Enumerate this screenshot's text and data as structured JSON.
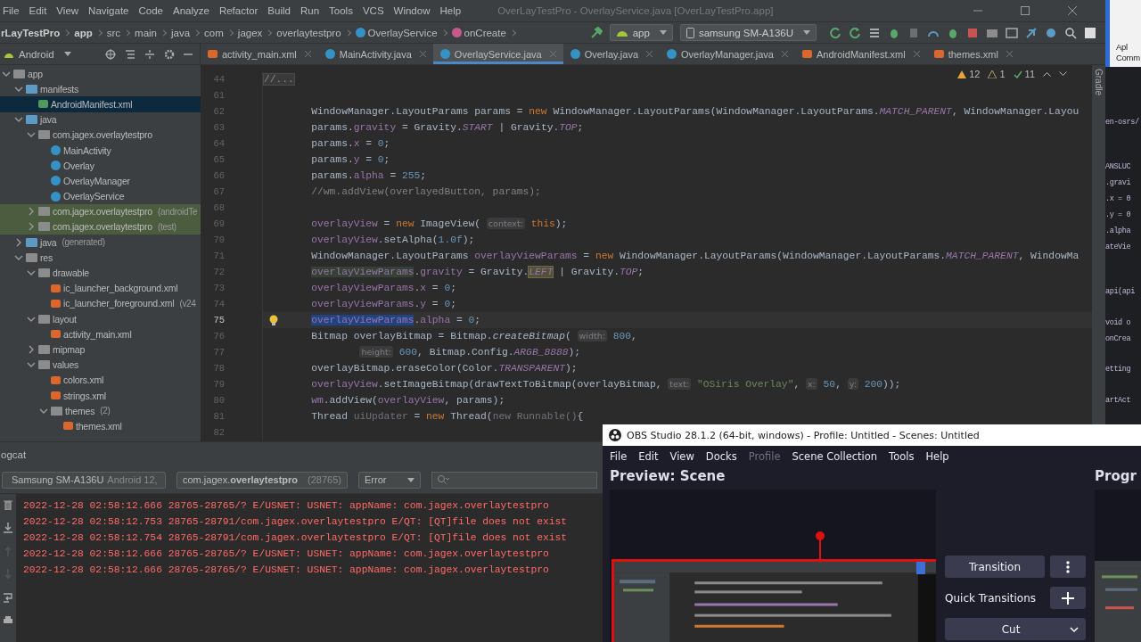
{
  "ide": {
    "menu": [
      "File",
      "Edit",
      "View",
      "Navigate",
      "Code",
      "Analyze",
      "Refactor",
      "Build",
      "Run",
      "Tools",
      "VCS",
      "Window",
      "Help"
    ],
    "title": "OverLayTestPro - OverlayService.java [OverLayTestPro.app]",
    "breadcrumb": [
      {
        "label": "rLayTestPro",
        "kind": "project"
      },
      {
        "label": "app",
        "kind": "module"
      },
      {
        "label": "src",
        "kind": "folder"
      },
      {
        "label": "main",
        "kind": "folder"
      },
      {
        "label": "java",
        "kind": "folder"
      },
      {
        "label": "com",
        "kind": "folder"
      },
      {
        "label": "jagex",
        "kind": "folder"
      },
      {
        "label": "overlaytestpro",
        "kind": "folder"
      },
      {
        "label": "OverlayService",
        "kind": "class"
      },
      {
        "label": "onCreate",
        "kind": "method"
      }
    ],
    "run_config": "app",
    "device": "samsung SM-A136U",
    "project_view": "Android",
    "tabs": [
      {
        "label": "activity_main.xml",
        "kind": "xml",
        "selected": false
      },
      {
        "label": "MainActivity.java",
        "kind": "class",
        "selected": false
      },
      {
        "label": "OverlayService.java",
        "kind": "class",
        "selected": true
      },
      {
        "label": "Overlay.java",
        "kind": "class",
        "selected": false
      },
      {
        "label": "OverlayManager.java",
        "kind": "class",
        "selected": false
      },
      {
        "label": "AndroidManifest.xml",
        "kind": "xml",
        "selected": false
      },
      {
        "label": "themes.xml",
        "kind": "xml",
        "selected": false
      }
    ],
    "inspections": {
      "warnings": "12",
      "weak_warnings": "1",
      "typos": "11"
    },
    "side_tool": "Gradle",
    "tree": [
      {
        "label": "app",
        "kind": "module",
        "expanded": true,
        "selected": false,
        "highlighted": false,
        "children": [
          {
            "label": "manifests",
            "kind": "source-folder",
            "expanded": true,
            "selected": false,
            "highlighted": false,
            "children": [
              {
                "label": "AndroidManifest.xml",
                "kind": "manifest",
                "selected": true,
                "highlighted": false
              }
            ]
          },
          {
            "label": "java",
            "kind": "source-folder",
            "expanded": true,
            "selected": false,
            "highlighted": false,
            "children": [
              {
                "label": "com.jagex.overlaytestpro",
                "kind": "package",
                "expanded": true,
                "selected": false,
                "highlighted": false,
                "children": [
                  {
                    "label": "MainActivity",
                    "kind": "class",
                    "selected": false,
                    "highlighted": false
                  },
                  {
                    "label": "Overlay",
                    "kind": "class",
                    "selected": false,
                    "highlighted": false
                  },
                  {
                    "label": "OverlayManager",
                    "kind": "class",
                    "selected": false,
                    "highlighted": false
                  },
                  {
                    "label": "OverlayService",
                    "kind": "class",
                    "selected": false,
                    "highlighted": false
                  }
                ]
              },
              {
                "label": "com.jagex.overlaytestpro",
                "hint": "(androidTe",
                "kind": "package",
                "expanded": false,
                "selected": false,
                "highlighted": true
              },
              {
                "label": "com.jagex.overlaytestpro",
                "hint": "(test)",
                "kind": "package",
                "expanded": false,
                "selected": false,
                "highlighted": true
              }
            ]
          },
          {
            "label": "java",
            "hint": "(generated)",
            "kind": "generated",
            "expanded": false,
            "selected": false,
            "highlighted": false
          },
          {
            "label": "res",
            "kind": "res",
            "expanded": true,
            "selected": false,
            "highlighted": false,
            "children": [
              {
                "label": "drawable",
                "kind": "folder",
                "expanded": true,
                "selected": false,
                "highlighted": false,
                "children": [
                  {
                    "label": "ic_launcher_background.xml",
                    "kind": "xml",
                    "selected": false,
                    "highlighted": false
                  },
                  {
                    "label": "ic_launcher_foreground.xml",
                    "hint": "(v24",
                    "kind": "xml",
                    "selected": false,
                    "highlighted": false
                  }
                ]
              },
              {
                "label": "layout",
                "kind": "folder",
                "expanded": true,
                "selected": false,
                "highlighted": false,
                "children": [
                  {
                    "label": "activity_main.xml",
                    "kind": "xml",
                    "selected": false,
                    "highlighted": false
                  }
                ]
              },
              {
                "label": "mipmap",
                "kind": "folder",
                "expanded": false,
                "selected": false,
                "highlighted": false
              },
              {
                "label": "values",
                "kind": "folder",
                "expanded": true,
                "selected": false,
                "highlighted": false,
                "children": [
                  {
                    "label": "colors.xml",
                    "kind": "xml",
                    "selected": false,
                    "highlighted": false
                  },
                  {
                    "label": "strings.xml",
                    "kind": "xml",
                    "selected": false,
                    "highlighted": false
                  },
                  {
                    "label": "themes",
                    "hint": "(2)",
                    "kind": "folder",
                    "expanded": true,
                    "selected": false,
                    "highlighted": false,
                    "children": [
                      {
                        "label": "themes.xml",
                        "kind": "xml",
                        "selected": false,
                        "highlighted": false
                      }
                    ]
                  }
                ]
              }
            ]
          }
        ]
      }
    ],
    "code_lines": [
      {
        "number": "44",
        "current": false,
        "tokens": [
          {
            "text": "//...",
            "kind": "fold"
          }
        ]
      },
      {
        "number": "61",
        "current": false
      },
      {
        "number": "62",
        "current": false,
        "tokens": [
          {
            "text": "        WindowManager.LayoutParams params = ",
            "kind": "plain"
          },
          {
            "text": "new",
            "kind": "keyword"
          },
          {
            "text": " WindowManager.LayoutParams(WindowManager.LayoutParams.",
            "kind": "plain"
          },
          {
            "text": "MATCH_PARENT",
            "kind": "static"
          },
          {
            "text": ", WindowManager.Layou",
            "kind": "plain"
          }
        ]
      },
      {
        "number": "63",
        "current": false,
        "tokens": [
          {
            "text": "        params.",
            "kind": "plain"
          },
          {
            "text": "gravity",
            "kind": "field"
          },
          {
            "text": " = Gravity.",
            "kind": "plain"
          },
          {
            "text": "START",
            "kind": "static"
          },
          {
            "text": " | Gravity.",
            "kind": "plain"
          },
          {
            "text": "TOP",
            "kind": "static"
          },
          {
            "text": ";",
            "kind": "plain"
          }
        ]
      },
      {
        "number": "64",
        "current": false,
        "tokens": [
          {
            "text": "        params.",
            "kind": "plain"
          },
          {
            "text": "x",
            "kind": "field"
          },
          {
            "text": " = ",
            "kind": "plain"
          },
          {
            "text": "0",
            "kind": "number"
          },
          {
            "text": ";",
            "kind": "plain"
          }
        ]
      },
      {
        "number": "65",
        "current": false,
        "tokens": [
          {
            "text": "        params.",
            "kind": "plain"
          },
          {
            "text": "y",
            "kind": "field"
          },
          {
            "text": " = ",
            "kind": "plain"
          },
          {
            "text": "0",
            "kind": "number"
          },
          {
            "text": ";",
            "kind": "plain"
          }
        ]
      },
      {
        "number": "66",
        "current": false,
        "tokens": [
          {
            "text": "        params.",
            "kind": "plain"
          },
          {
            "text": "alpha",
            "kind": "field"
          },
          {
            "text": " = ",
            "kind": "plain"
          },
          {
            "text": "255",
            "kind": "number"
          },
          {
            "text": ";",
            "kind": "plain"
          }
        ]
      },
      {
        "number": "67",
        "current": false,
        "tokens": [
          {
            "text": "        //wm.addView(overlayedButton, params);",
            "kind": "comment"
          }
        ]
      },
      {
        "number": "68",
        "current": false
      },
      {
        "number": "69",
        "current": false,
        "tokens": [
          {
            "text": "        overlayView",
            "kind": "field"
          },
          {
            "text": " = ",
            "kind": "plain"
          },
          {
            "text": "new",
            "kind": "keyword"
          },
          {
            "text": " ImageView( ",
            "kind": "plain"
          },
          {
            "text": "context:",
            "kind": "hint"
          },
          {
            "text": " this",
            "kind": "keyword"
          },
          {
            "text": ");",
            "kind": "plain"
          }
        ]
      },
      {
        "number": "70",
        "current": false,
        "tokens": [
          {
            "text": "        overlayView",
            "kind": "field"
          },
          {
            "text": ".setAlpha(",
            "kind": "plain"
          },
          {
            "text": "1.0f",
            "kind": "number"
          },
          {
            "text": ");",
            "kind": "plain"
          }
        ]
      },
      {
        "number": "71",
        "current": false,
        "tokens": [
          {
            "text": "        WindowManager.LayoutParams ",
            "kind": "plain"
          },
          {
            "text": "overlayViewParams",
            "kind": "field"
          },
          {
            "text": " = ",
            "kind": "plain"
          },
          {
            "text": "new",
            "kind": "keyword"
          },
          {
            "text": " WindowManager.LayoutParams(WindowManager.LayoutParams.",
            "kind": "plain"
          },
          {
            "text": "MATCH_PARENT",
            "kind": "static"
          },
          {
            "text": ", WindowMa",
            "kind": "plain"
          }
        ]
      },
      {
        "number": "72",
        "current": false,
        "tokens": [
          {
            "text": "        overlayViewParams",
            "kind": "usage"
          },
          {
            "text": ".",
            "kind": "plain"
          },
          {
            "text": "gravity",
            "kind": "field"
          },
          {
            "text": " = Gravity.",
            "kind": "plain"
          },
          {
            "text": "LEFT",
            "kind": "boxed"
          },
          {
            "text": " | Gravity.",
            "kind": "plain"
          },
          {
            "text": "TOP",
            "kind": "static"
          },
          {
            "text": ";",
            "kind": "plain"
          }
        ]
      },
      {
        "number": "73",
        "current": false,
        "tokens": [
          {
            "text": "        overlayViewParams",
            "kind": "field"
          },
          {
            "text": ".",
            "kind": "plain"
          },
          {
            "text": "x",
            "kind": "field"
          },
          {
            "text": " = ",
            "kind": "plain"
          },
          {
            "text": "0",
            "kind": "number"
          },
          {
            "text": ";",
            "kind": "plain"
          }
        ]
      },
      {
        "number": "74",
        "current": false,
        "tokens": [
          {
            "text": "        overlayViewParams",
            "kind": "field"
          },
          {
            "text": ".",
            "kind": "plain"
          },
          {
            "text": "y",
            "kind": "field"
          },
          {
            "text": " = ",
            "kind": "plain"
          },
          {
            "text": "0",
            "kind": "number"
          },
          {
            "text": ";",
            "kind": "plain"
          }
        ]
      },
      {
        "number": "75",
        "current": true,
        "tokens": [
          {
            "text": "        overlayViewParams",
            "kind": "selection"
          },
          {
            "text": ".",
            "kind": "plain"
          },
          {
            "text": "alpha",
            "kind": "field"
          },
          {
            "text": " = ",
            "kind": "plain"
          },
          {
            "text": "0",
            "kind": "number"
          },
          {
            "text": ";",
            "kind": "plain"
          }
        ]
      },
      {
        "number": "76",
        "current": false,
        "tokens": [
          {
            "text": "        Bitmap overlayBitmap = Bitmap.",
            "kind": "plain"
          },
          {
            "text": "createBitmap",
            "kind": "method"
          },
          {
            "text": "( ",
            "kind": "plain"
          },
          {
            "text": "width:",
            "kind": "hint"
          },
          {
            "text": " 800",
            "kind": "number"
          },
          {
            "text": ",",
            "kind": "plain"
          }
        ]
      },
      {
        "number": "77",
        "current": false,
        "tokens": [
          {
            "text": "                height:",
            "kind": "hint"
          },
          {
            "text": " 600",
            "kind": "number"
          },
          {
            "text": ", Bitmap.Config.",
            "kind": "plain"
          },
          {
            "text": "ARGB_8888",
            "kind": "static"
          },
          {
            "text": ");",
            "kind": "plain"
          }
        ]
      },
      {
        "number": "78",
        "current": false,
        "tokens": [
          {
            "text": "        overlayBitmap.eraseColor(Color.",
            "kind": "plain"
          },
          {
            "text": "TRANSPARENT",
            "kind": "static"
          },
          {
            "text": ");",
            "kind": "plain"
          }
        ]
      },
      {
        "number": "79",
        "current": false,
        "tokens": [
          {
            "text": "        overlayView",
            "kind": "field"
          },
          {
            "text": ".setImageBitmap(drawTextToBitmap(overlayBitmap, ",
            "kind": "plain"
          },
          {
            "text": "text:",
            "kind": "hint"
          },
          {
            "text": " \"OSiris Overlay\"",
            "kind": "string"
          },
          {
            "text": ", ",
            "kind": "plain"
          },
          {
            "text": "x:",
            "kind": "hint"
          },
          {
            "text": " 50",
            "kind": "number"
          },
          {
            "text": ", ",
            "kind": "plain"
          },
          {
            "text": "y:",
            "kind": "hint"
          },
          {
            "text": " 200",
            "kind": "number"
          },
          {
            "text": "));",
            "kind": "plain"
          }
        ]
      },
      {
        "number": "80",
        "current": false,
        "tokens": [
          {
            "text": "        wm",
            "kind": "field"
          },
          {
            "text": ".addView(",
            "kind": "plain"
          },
          {
            "text": "overlayView",
            "kind": "field"
          },
          {
            "text": ", params);",
            "kind": "plain"
          }
        ]
      },
      {
        "number": "81",
        "current": false,
        "tokens": [
          {
            "text": "        Thread ",
            "kind": "plain"
          },
          {
            "text": "uiUpdater",
            "kind": "unused"
          },
          {
            "text": " = ",
            "kind": "plain"
          },
          {
            "text": "new",
            "kind": "keyword"
          },
          {
            "text": " Thread(",
            "kind": "plain"
          },
          {
            "text": "new Runnable()",
            "kind": "unused"
          },
          {
            "text": "{",
            "kind": "plain"
          }
        ]
      },
      {
        "number": "82",
        "current": false
      }
    ],
    "logcat": {
      "title": "ogcat",
      "device": "Samsung SM-A136U",
      "device_hint": "Android 12,",
      "process": "com.jagex.**overlaytestpro**",
      "process_hint": "(28765)",
      "level": "Error",
      "lines": [
        "2022-12-28 02:58:12.666 28765-28765/? E/USNET: USNET: appName: com.jagex.overlaytestpro",
        "2022-12-28 02:58:12.753 28765-28791/com.jagex.overlaytestpro E/QT: [QT]file does not exist",
        "2022-12-28 02:58:12.754 28765-28791/com.jagex.overlaytestpro E/QT: [QT]file does not exist",
        "2022-12-28 02:58:12.666 28765-28765/? E/USNET: USNET: appName: com.jagex.overlaytestpro",
        "2022-12-28 02:58:12.666 28765-28765/? E/USNET: USNET: appName: com.jagex.overlaytestpro"
      ]
    }
  },
  "obs": {
    "title": "OBS Studio 28.1.2 (64-bit, windows) - Profile: Untitled - Scenes: Untitled",
    "menu": [
      {
        "label": "File",
        "disabled": false
      },
      {
        "label": "Edit",
        "disabled": false
      },
      {
        "label": "View",
        "disabled": false
      },
      {
        "label": "Docks",
        "disabled": false
      },
      {
        "label": "Profile",
        "disabled": true
      },
      {
        "label": "Scene Collection",
        "disabled": false
      },
      {
        "label": "Tools",
        "disabled": false
      },
      {
        "label": "Help",
        "disabled": false
      }
    ],
    "preview_title": "Preview: Scene",
    "program_title": "Progr",
    "transition_button": "Transition",
    "quick_transitions": "Quick Transitions",
    "transition": "Cut"
  },
  "background_window": {
    "header": [
      "Apl",
      "Comm"
    ],
    "lines": [
      "en-osrs/",
      "ANSLUC",
      ".gravi",
      ".x = 0",
      ".y = 0",
      ".alpha",
      "ateVie",
      "api(api",
      "void o",
      "onCrea",
      "etting",
      "artAct"
    ]
  }
}
